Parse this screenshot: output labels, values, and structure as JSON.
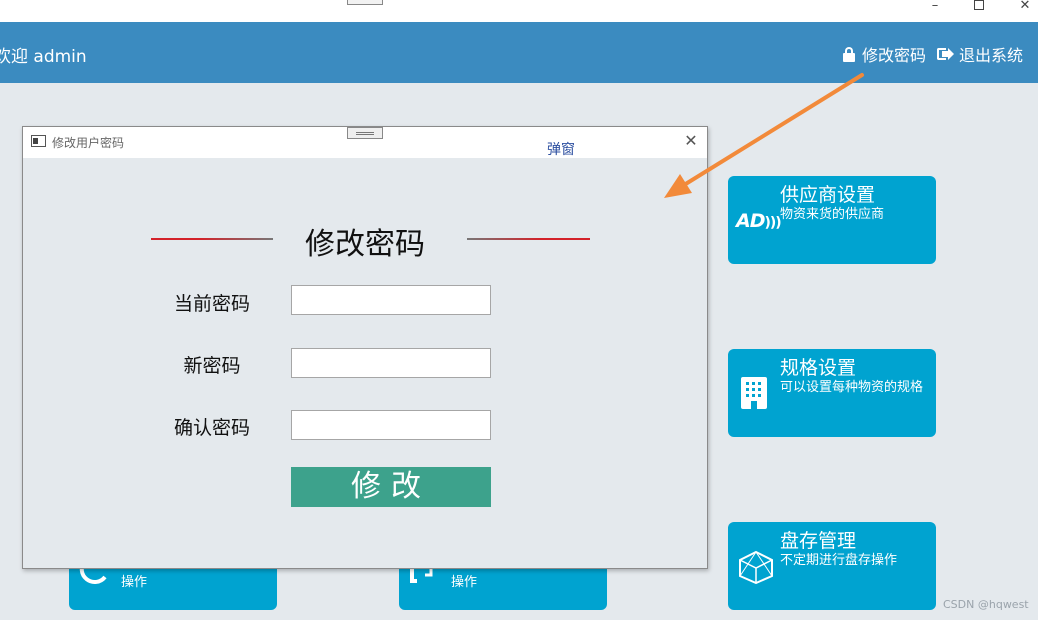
{
  "header": {
    "welcome": "欢迎 admin",
    "change_password_link": "修改密码",
    "logout_link": "退出系统"
  },
  "tiles": {
    "supplier": {
      "title": "供应商设置",
      "desc": "物资来货的供应商",
      "icon_text": "AD"
    },
    "spec": {
      "title": "规格设置",
      "desc": "可以设置每种物资的规格"
    },
    "stock": {
      "title": "盘存管理",
      "desc": "不定期进行盘存操作"
    },
    "partial_a": {
      "desc": "操作"
    },
    "partial_b": {
      "desc": "操作"
    }
  },
  "dialog": {
    "window_title": "修改用户密码",
    "tag": "弹窗",
    "heading": "修改密码",
    "fields": {
      "current_label": "当前密码",
      "current_value": "",
      "new_label": "新密码",
      "new_value": "",
      "confirm_label": "确认密码",
      "confirm_value": ""
    },
    "submit_label": "修改"
  },
  "watermark": "CSDN @hqwest",
  "colors": {
    "header_bg": "#3b8bc0",
    "tile_bg": "#00a3d0",
    "button_bg": "#3da28c",
    "accent_line": "#d3222a",
    "arrow": "#f28a3a"
  }
}
